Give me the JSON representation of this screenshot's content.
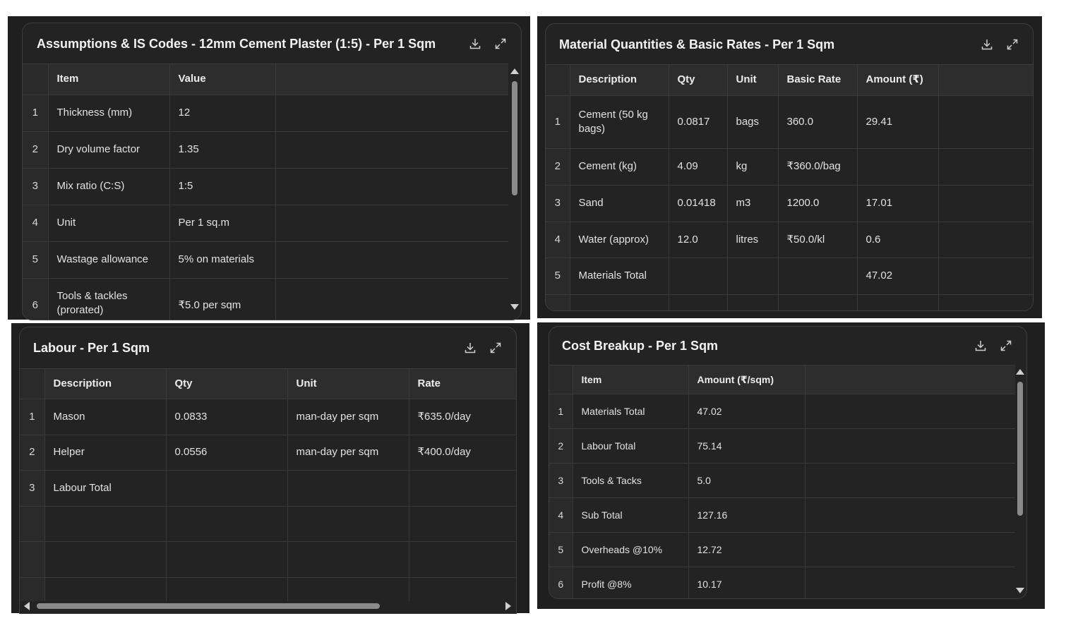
{
  "colors": {
    "panel_bg": "#1f1f1f",
    "card_bg": "#232323",
    "header_bg": "#2d2d2d",
    "border": "#3a3a3a",
    "scrollbar": "#8a8a8a"
  },
  "icons": [
    "download-icon",
    "expand-icon"
  ],
  "assumptions": {
    "title": "Assumptions & IS Codes - 12mm Cement Plaster (1:5) - Per 1 Sqm",
    "columns": [
      "Item",
      "Value"
    ],
    "rows": [
      {
        "idx": "1",
        "item": "Thickness (mm)",
        "value": "12"
      },
      {
        "idx": "2",
        "item": "Dry volume factor",
        "value": "1.35"
      },
      {
        "idx": "3",
        "item": "Mix ratio (C:S)",
        "value": "1:5"
      },
      {
        "idx": "4",
        "item": "Unit",
        "value": "Per 1 sq.m"
      },
      {
        "idx": "5",
        "item": "Wastage allowance",
        "value": "5% on materials"
      },
      {
        "idx": "6",
        "item": "Tools & tackles (prorated)",
        "value": "₹5.0 per sqm"
      }
    ]
  },
  "materials": {
    "title": "Material Quantities & Basic Rates - Per 1 Sqm",
    "columns": [
      "Description",
      "Qty",
      "Unit",
      "Basic Rate",
      "Amount (₹)"
    ],
    "rows": [
      {
        "idx": "1",
        "description": "Cement (50 kg bags)",
        "qty": "0.0817",
        "unit": "bags",
        "rate": "360.0",
        "amount": "29.41"
      },
      {
        "idx": "2",
        "description": "Cement (kg)",
        "qty": "4.09",
        "unit": "kg",
        "rate": "₹360.0/bag",
        "amount": ""
      },
      {
        "idx": "3",
        "description": "Sand",
        "qty": "0.01418",
        "unit": "m3",
        "rate": "1200.0",
        "amount": "17.01"
      },
      {
        "idx": "4",
        "description": "Water (approx)",
        "qty": "12.0",
        "unit": "litres",
        "rate": "₹50.0/kl",
        "amount": "0.6"
      },
      {
        "idx": "5",
        "description": "Materials Total",
        "qty": "",
        "unit": "",
        "rate": "",
        "amount": "47.02"
      }
    ]
  },
  "labour": {
    "title": "Labour - Per 1 Sqm",
    "columns": [
      "Description",
      "Qty",
      "Unit",
      "Rate"
    ],
    "rows": [
      {
        "idx": "1",
        "description": "Mason",
        "qty": "0.0833",
        "unit": "man-day per sqm",
        "rate": "₹635.0/day"
      },
      {
        "idx": "2",
        "description": "Helper",
        "qty": "0.0556",
        "unit": "man-day per sqm",
        "rate": "₹400.0/day"
      },
      {
        "idx": "3",
        "description": "Labour Total",
        "qty": "",
        "unit": "",
        "rate": ""
      }
    ]
  },
  "cost": {
    "title": "Cost Breakup - Per 1 Sqm",
    "columns": [
      "Item",
      "Amount (₹/sqm)"
    ],
    "rows": [
      {
        "idx": "1",
        "item": "Materials Total",
        "amount": "47.02"
      },
      {
        "idx": "2",
        "item": "Labour Total",
        "amount": "75.14"
      },
      {
        "idx": "3",
        "item": "Tools & Tacks",
        "amount": "5.0"
      },
      {
        "idx": "4",
        "item": "Sub Total",
        "amount": "127.16"
      },
      {
        "idx": "5",
        "item": "Overheads @10%",
        "amount": "12.72"
      },
      {
        "idx": "6",
        "item": "Profit @8%",
        "amount": "10.17"
      }
    ]
  }
}
